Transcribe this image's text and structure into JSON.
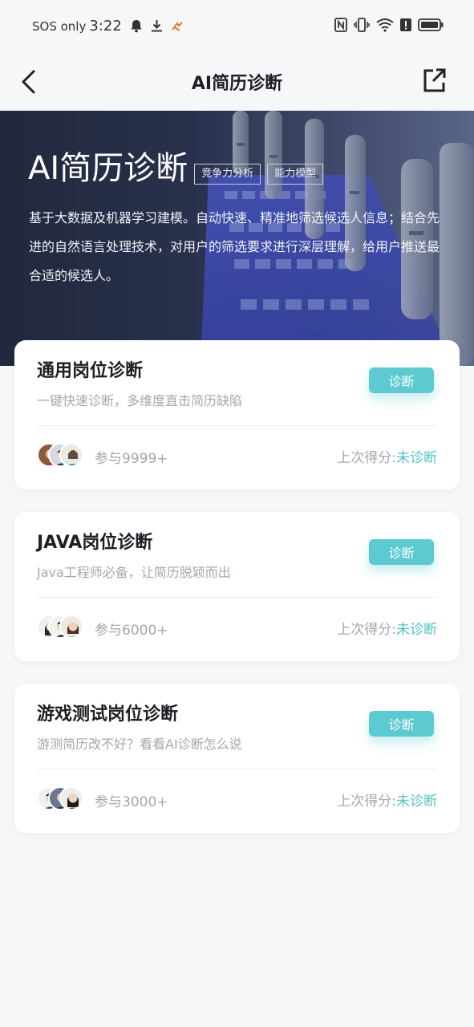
{
  "status_bar": {
    "carrier": "SOS only",
    "time": "3:22"
  },
  "nav": {
    "title": "AI简历诊断"
  },
  "hero": {
    "title": "AI简历诊断",
    "tags": [
      "竞争力分析",
      "能力模型"
    ],
    "description": "基于大数据及机器学习建模。自动快速、精准地筛选候选人信息；结合先进的自然语言处理技术，对用户的筛选要求进行深层理解，给用户推送最合适的候选人。"
  },
  "cards": [
    {
      "title": "通用岗位诊断",
      "subtitle": "一键快速诊断，多维度直击简历缺陷",
      "button": "诊断",
      "participants": "参与9999+",
      "score_label": "上次得分:",
      "score_value": "未诊断"
    },
    {
      "title": "JAVA岗位诊断",
      "subtitle": "Java工程师必备，让简历脱颖而出",
      "button": "诊断",
      "participants": "参与6000+",
      "score_label": "上次得分:",
      "score_value": "未诊断"
    },
    {
      "title": "游戏测试岗位诊断",
      "subtitle": "游测简历改不好？看看AI诊断怎么说",
      "button": "诊断",
      "participants": "参与3000+",
      "score_label": "上次得分:",
      "score_value": "未诊断"
    }
  ],
  "colors": {
    "accent": "#5ccad0",
    "score": "#4ec2c9",
    "background": "#f6f7f9"
  }
}
